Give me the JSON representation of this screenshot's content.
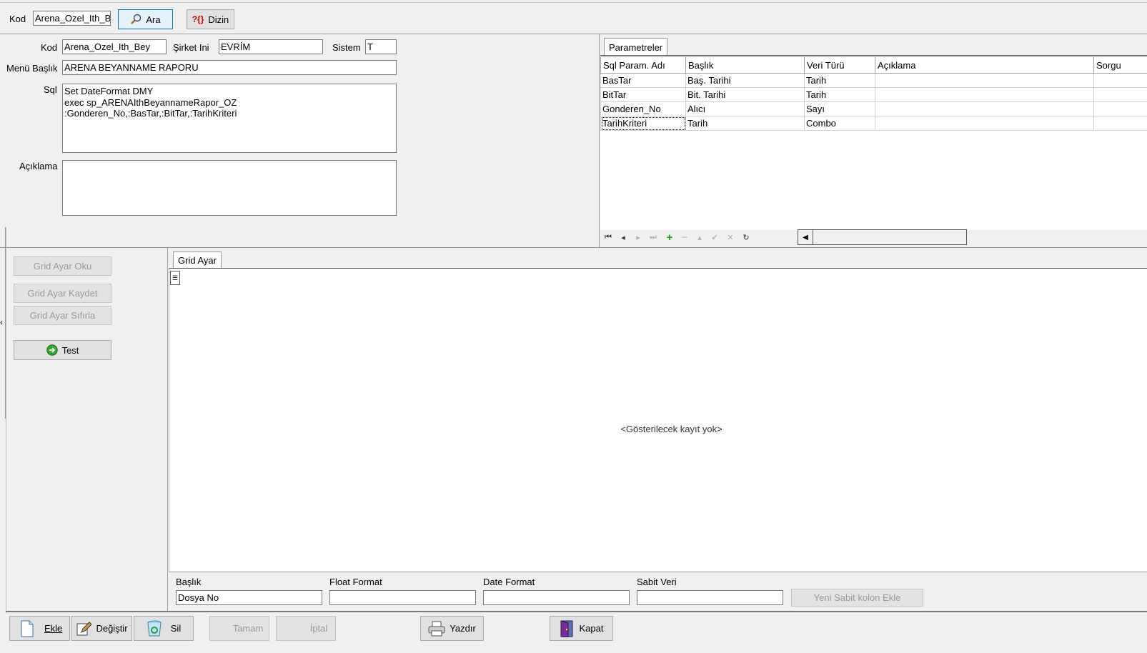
{
  "top": {
    "kod_label": "Kod",
    "kod_value": "Arena_Ozel_Ith_B",
    "ara_label": "Ara",
    "dizin_label": "Dizin"
  },
  "form": {
    "kod_label": "Kod",
    "kod_value": "Arena_Ozel_Ith_Bey",
    "sirket_label": "Şirket Ini",
    "sirket_value": "EVRİM",
    "sistem_label": "Sistem",
    "sistem_value": "T",
    "menu_label": "Menü Başlık",
    "menu_value": "ARENA BEYANNAME RAPORU",
    "sql_label": "Sql",
    "sql_lines": [
      "Set DateFormat DMY",
      "exec sp_ARENAIthBeyannameRapor_OZ",
      ":Gonderen_No,:BasTar,:BitTar,:TarihKriteri"
    ],
    "aciklama_label": "Açıklama",
    "aciklama_value": ""
  },
  "params": {
    "tab_label": "Parametreler",
    "columns": [
      "Sql Param. Adı",
      "Başlık",
      "Veri Türü",
      "Açıklama",
      "Sorgu"
    ],
    "rows": [
      [
        "BasTar",
        "Baş. Tarihi",
        "Tarih",
        "",
        ""
      ],
      [
        "BitTar",
        "Bit. Tarihi",
        "Tarih",
        "",
        ""
      ],
      [
        "Gonderen_No",
        "Alıcı",
        "Sayı",
        "",
        ""
      ],
      [
        "TarihKriteri",
        "Tarih",
        "Combo",
        "",
        ""
      ]
    ]
  },
  "left_buttons": {
    "grid_oku": "Grid Ayar Oku",
    "grid_kaydet": "Grid Ayar Kaydet",
    "grid_sifirla": "Grid Ayar Sıfırla",
    "test": "Test"
  },
  "grid_ayar": {
    "tab_label": "Grid Ayar",
    "empty_text": "<Gösterilecek kayıt yok>"
  },
  "bottom_fields": {
    "baslik_label": "Başlık",
    "baslik_value": "Dosya No",
    "float_label": "Float Format",
    "float_value": "",
    "date_label": "Date Format",
    "date_value": "",
    "sabit_label": "Sabit Veri",
    "sabit_value": "",
    "yeni_sabit_button": "Yeni Sabit kolon Ekle"
  },
  "toolbar": {
    "ekle": "Ekle",
    "degistir": "Değiştir",
    "sil": "Sil",
    "tamam": "Tamam",
    "iptal": "İptal",
    "yazdir": "Yazdır",
    "kapat": "Kapat"
  }
}
